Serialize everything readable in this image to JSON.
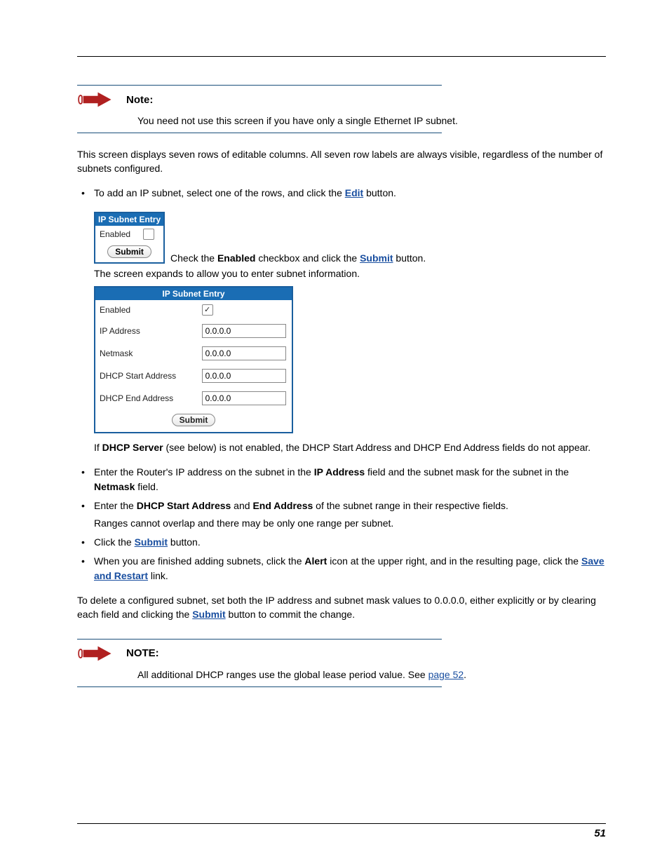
{
  "page_number": "51",
  "note1": {
    "label": "Note:",
    "text": "You need not use this screen if you have only a single Ethernet IP subnet."
  },
  "intro": "This screen displays seven rows of editable columns. All seven row labels are always visible, regardless of the number of subnets configured.",
  "bullet_add": {
    "pre": "To add an IP subnet, select one of the rows, and click the ",
    "link": "Edit",
    "post": " button."
  },
  "subnet_small": {
    "header": "IP Subnet Entry",
    "enabled_label": "Enabled",
    "submit": "Submit"
  },
  "after_small_box": {
    "pre": "Check the ",
    "bold1": "Enabled",
    "mid": " checkbox and click the ",
    "link": "Submit",
    "post": " button."
  },
  "expand_line": "The screen expands to allow you to enter subnet information.",
  "subnet_large": {
    "header": "IP Subnet Entry",
    "rows": {
      "enabled": "Enabled",
      "ip_address": "IP Address",
      "netmask": "Netmask",
      "dhcp_start": "DHCP Start Address",
      "dhcp_end": "DHCP End Address"
    },
    "values": {
      "ip_address": "0.0.0.0",
      "netmask": "0.0.0.0",
      "dhcp_start": "0.0.0.0",
      "dhcp_end": "0.0.0.0"
    },
    "submit": "Submit"
  },
  "dhcp_note": {
    "pre": "If ",
    "bold": "DHCP Server",
    "post": " (see below) is not enabled, the DHCP Start Address and DHCP End Address fields do not appear."
  },
  "bullet_ip": {
    "t1": "Enter the Router's IP address on the subnet in the ",
    "b1": "IP Address",
    "t2": " field and the subnet mask for the subnet in the ",
    "b2": "Netmask",
    "t3": " field."
  },
  "bullet_dhcp": {
    "t1": "Enter the ",
    "b1": "DHCP Start Address",
    "t2": " and ",
    "b2": "End Address",
    "t3": " of the subnet range in their respective fields.",
    "line2": "Ranges cannot overlap and there may be only one range per subnet."
  },
  "bullet_submit": {
    "t1": "Click the ",
    "link": "Submit",
    "t2": " button."
  },
  "bullet_alert": {
    "t1": "When you are finished adding subnets, click the ",
    "b1": "Alert",
    "t2": " icon at the upper right, and in the resulting page, click the ",
    "link": "Save and Restart",
    "t3": " link."
  },
  "delete_para": {
    "t1": "To delete a configured subnet, set both the IP address and subnet mask values to 0.0.0.0, either explicitly or by clearing each field and clicking the ",
    "link": "Submit",
    "t2": " button to commit the change."
  },
  "note2": {
    "label": "NOTE:",
    "t1": "All additional DHCP ranges use the global lease period value. See ",
    "link": "page 52",
    "t2": "."
  }
}
